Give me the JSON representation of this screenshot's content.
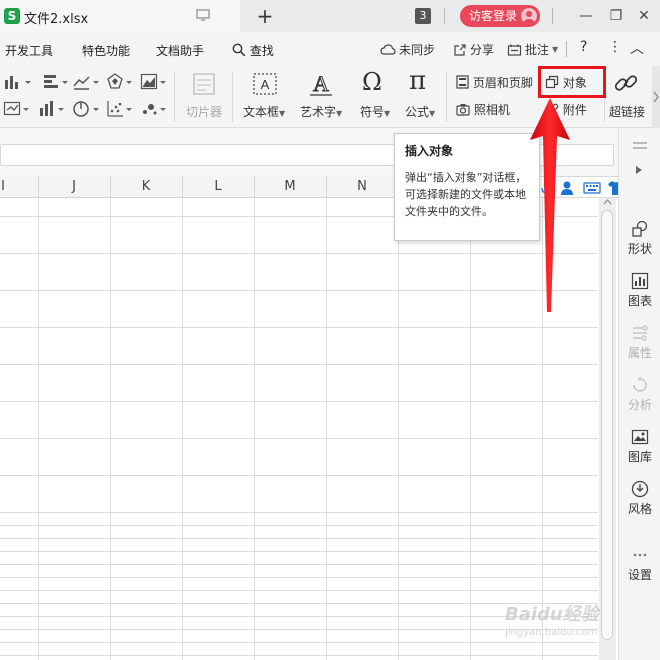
{
  "titlebar": {
    "doc_icon_letter": "S",
    "doc_name": "文件2.xlsx",
    "add_tab": "+",
    "tab_count": "3",
    "guest_login": "访客登录",
    "min": "—",
    "restore": "❐",
    "close": "✕"
  },
  "menubar": {
    "items": [
      "开发工具",
      "特色功能",
      "文档助手",
      "查找"
    ],
    "not_synced": "未同步",
    "share": "分享",
    "annotate": "批注",
    "help": "?",
    "more": "⋮",
    "collapse": "︿"
  },
  "ribbon": {
    "slicer": "切片器",
    "textbox": "文本框",
    "wordart": "艺术字",
    "symbol": "符号",
    "formula": "公式",
    "header_footer": "页眉和页脚",
    "object": "对象",
    "camera": "照相机",
    "attachment": "附件",
    "hyperlink": "超链接",
    "symbol_glyph": "Ω",
    "formula_glyph": "π",
    "wordart_glyph": "A"
  },
  "columns": [
    "I",
    "J",
    "K",
    "L",
    "M",
    "N"
  ],
  "tooltip": {
    "title": "插入对象",
    "body": "弹出“插入对象”对话框，可选择新建的文件或本地文件夹中的文件。"
  },
  "right_panel": {
    "items": [
      {
        "label": "形状",
        "icon": "shape-icon",
        "enabled": true
      },
      {
        "label": "图表",
        "icon": "chart-icon",
        "enabled": true
      },
      {
        "label": "属性",
        "icon": "property-icon",
        "enabled": false
      },
      {
        "label": "分析",
        "icon": "analysis-icon",
        "enabled": false
      },
      {
        "label": "图库",
        "icon": "gallery-icon",
        "enabled": true
      },
      {
        "label": "风格",
        "icon": "style-icon",
        "enabled": true
      },
      {
        "label": "设置",
        "icon": "settings-icon",
        "enabled": true
      }
    ]
  },
  "watermark": {
    "main": "Baidu经验",
    "sub": "jingyan.baidu.com"
  },
  "colors": {
    "accent_red": "#e8141b",
    "guest_btn": "#e8485a",
    "wps_green": "#1fa34a",
    "mini_toolbar_blue": "#1a73d1"
  }
}
